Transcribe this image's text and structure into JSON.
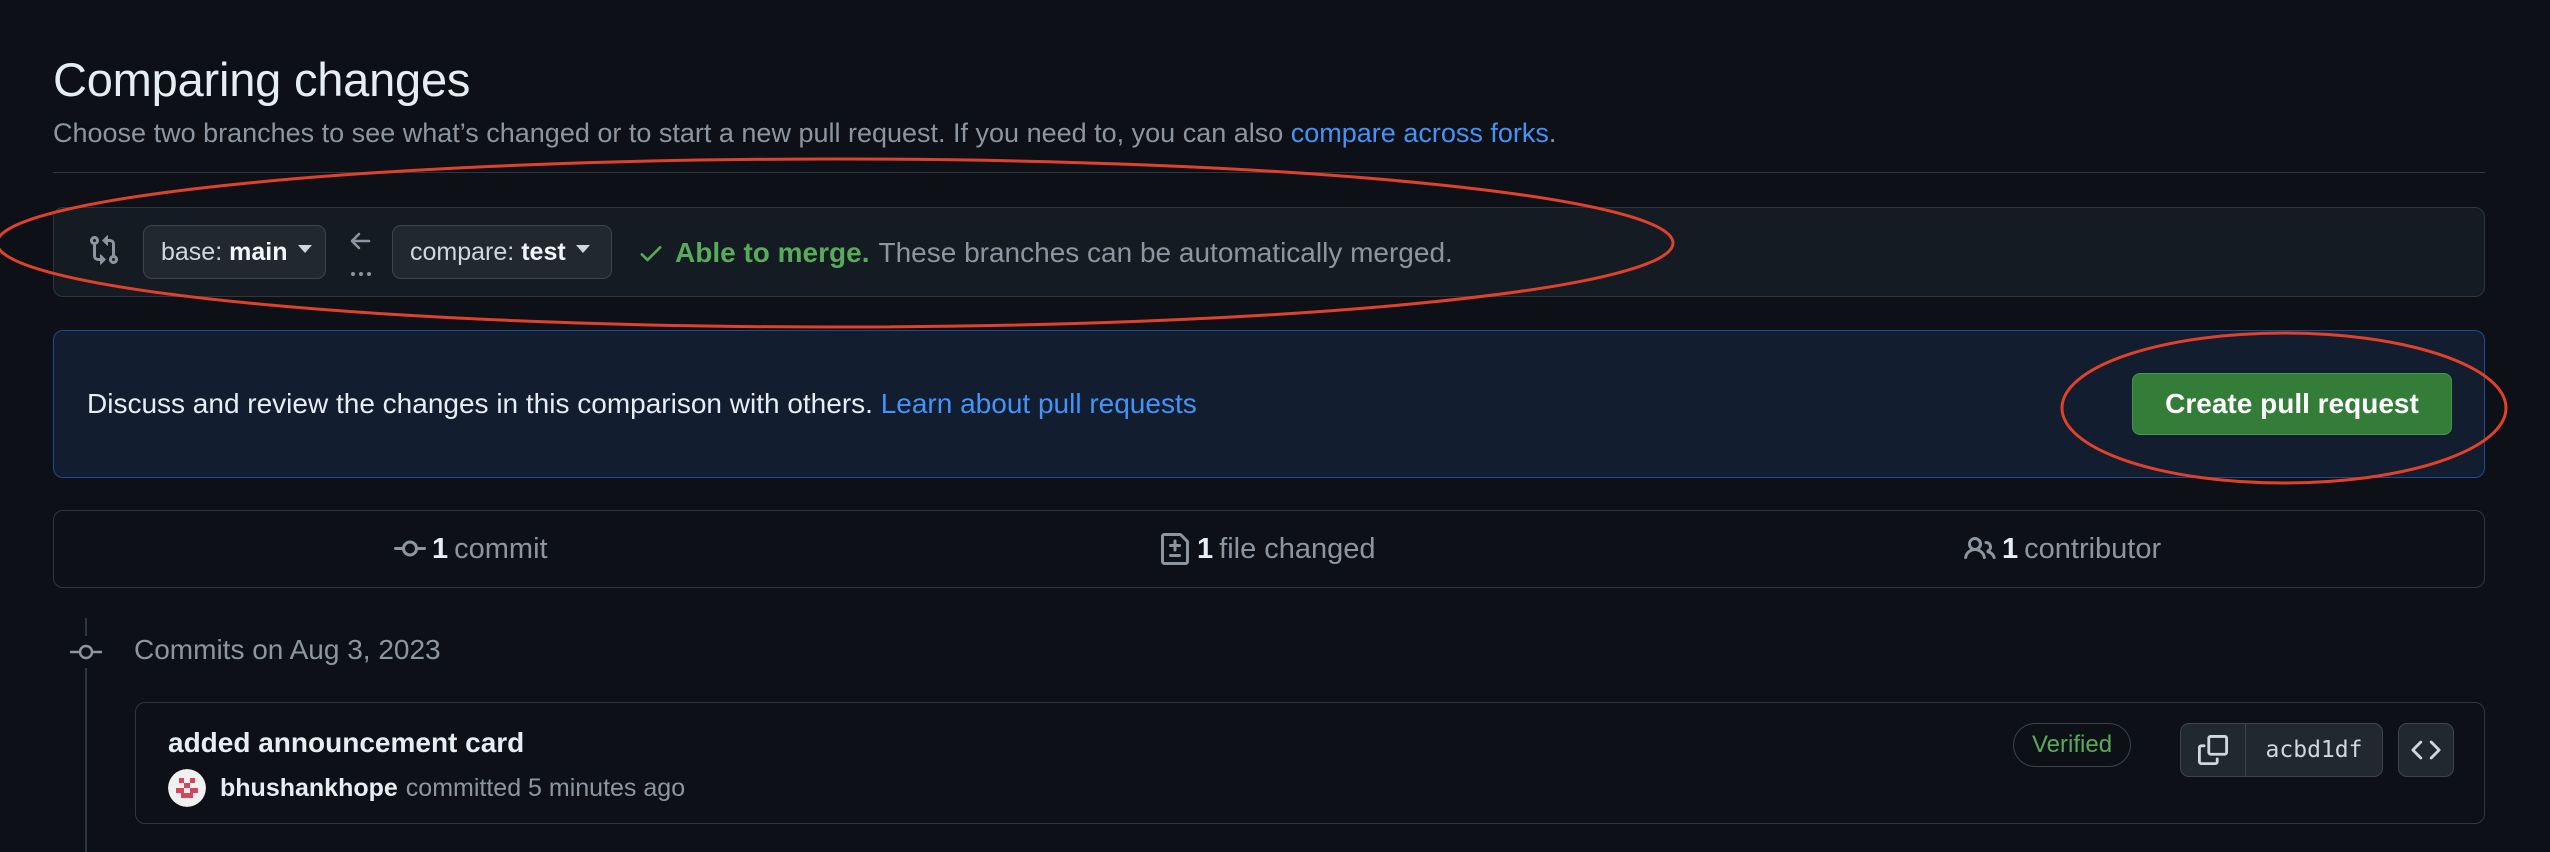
{
  "header": {
    "title": "Comparing changes",
    "subtitle": "Choose two branches to see what’s changed or to start a new pull request. If you need to, you can also ",
    "subtitle_link": "compare across forks",
    "subtitle_end": "."
  },
  "compare": {
    "base_prefix": "base:",
    "base_branch": "main",
    "compare_prefix": "compare:",
    "compare_branch": "test",
    "merge_ok": "Able to merge.",
    "merge_detail": "These branches can be automatically merged."
  },
  "discuss": {
    "text": "Discuss and review the changes in this comparison with others. ",
    "link": "Learn about pull requests",
    "button": "Create pull request"
  },
  "stats": {
    "commits_count": "1",
    "commits_label": "commit",
    "files_count": "1",
    "files_label": "file changed",
    "contributors_count": "1",
    "contributors_label": "contributor"
  },
  "timeline": {
    "date_label": "Commits on Aug 3, 2023",
    "commit": {
      "title": "added announcement card",
      "author": "bhushankhope",
      "action": "committed 5 minutes ago",
      "verified": "Verified",
      "sha": "acbd1df"
    }
  },
  "colors": {
    "background": "#0d1117",
    "accent_link": "#4493f8",
    "success": "#57ab5a",
    "primary_button": "#347d39",
    "annotation": "#e0412b"
  },
  "icons": [
    "git-compare-icon",
    "caret-down-icon",
    "arrow-left-icon",
    "check-icon",
    "git-commit-icon",
    "file-diff-icon",
    "people-icon",
    "copy-icon",
    "code-icon"
  ]
}
